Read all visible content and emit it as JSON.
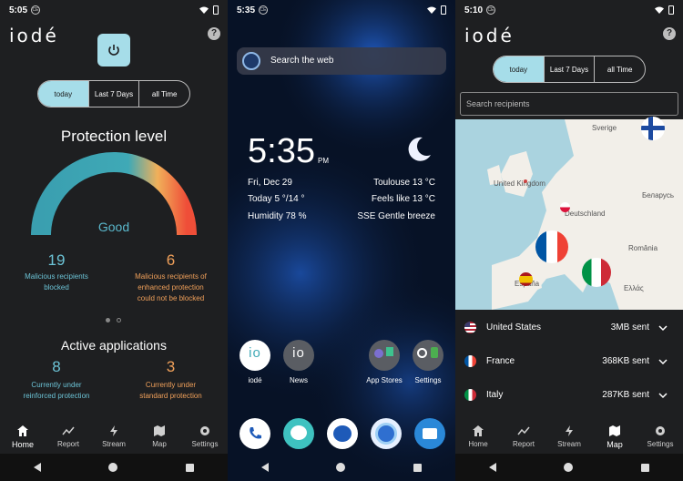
{
  "screen1": {
    "status_time": "5:05",
    "status_badge": "CE",
    "logo": "iodé",
    "help": "?",
    "segments": [
      "today",
      "Last 7 Days",
      "all Time"
    ],
    "protection_title": "Protection level",
    "gauge_label": "Good",
    "blocked_count": "19",
    "blocked_label": "Malicious recipients blocked",
    "enhanced_count": "6",
    "enhanced_label": "Malicious recipients of enhanced protection could not be blocked",
    "active_title": "Active applications",
    "reinforced_count": "8",
    "reinforced_label": "Currently under reinforced protection",
    "standard_count": "3",
    "standard_label": "Currently under standard protection",
    "nav": [
      "Home",
      "Report",
      "Stream",
      "Map",
      "Settings"
    ],
    "accent": "#a6dde9",
    "orange": "#f0a05a"
  },
  "screen2": {
    "status_time": "5:35",
    "status_badge": "CE",
    "search_placeholder": "Search the web",
    "clock": "5:35",
    "clock_suffix": "PM",
    "date": "Fri, Dec 29",
    "location": "Toulouse 13 °C",
    "today_temp": "Today 5 °/14 °",
    "feels_like": "Feels like 13 °C",
    "humidity": "Humidity 78 %",
    "wind": "SSE Gentle breeze",
    "apps": [
      "iodé",
      "News",
      "App Stores",
      "Settings"
    ]
  },
  "screen3": {
    "status_time": "5:10",
    "status_badge": "CE",
    "logo": "iodé",
    "help": "?",
    "segments": [
      "today",
      "Last 7 Days",
      "all Time"
    ],
    "search_placeholder": "Search recipients",
    "map_labels": [
      "Sverige",
      "United Kingdom",
      "Deutschland",
      "Беларусь",
      "România",
      "España",
      "Ελλάς"
    ],
    "countries": [
      {
        "name": "United States",
        "sent": "3MB sent"
      },
      {
        "name": "France",
        "sent": "368KB sent"
      },
      {
        "name": "Italy",
        "sent": "287KB sent"
      }
    ],
    "nav": [
      "Home",
      "Report",
      "Stream",
      "Map",
      "Settings"
    ]
  }
}
